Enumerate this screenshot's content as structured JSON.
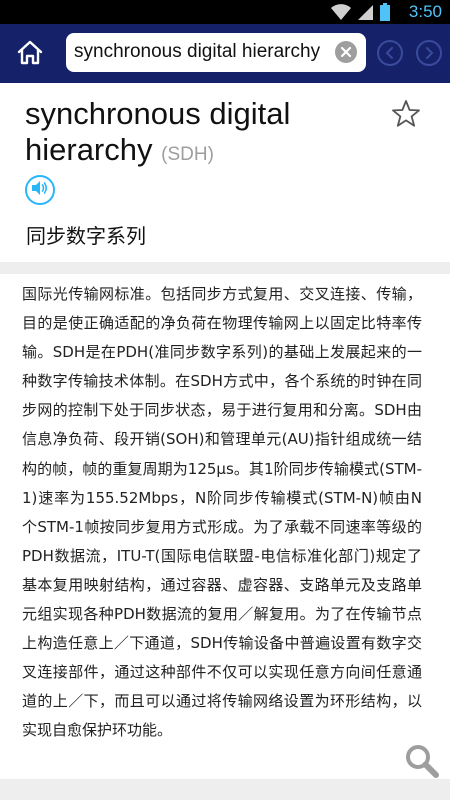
{
  "status_bar": {
    "time": "3:50",
    "icons": [
      "wifi-icon",
      "cell-signal-icon",
      "battery-icon"
    ]
  },
  "app_bar": {
    "search_value": "synchronous digital hierarchy",
    "icons": [
      "home-icon",
      "clear-icon",
      "back-arrow-icon",
      "forward-arrow-icon"
    ],
    "background_color": "#15226a"
  },
  "entry": {
    "term": "synchronous digital hierarchy",
    "abbreviation": "(SDH)",
    "translation": "同步数字系列",
    "definition": "国际光传输网标准。包括同步方式复用、交叉连接、传输，目的是使正确适配的净负荷在物理传输网上以固定比特率传输。SDH是在PDH(准同步数字系列)的基础上发展起来的一种数字传输技术体制。在SDH方式中，各个系统的时钟在同步网的控制下处于同步状态，易于进行复用和分离。SDH由信息净负荷、段开销(SOH)和管理单元(AU)指针组成统一结构的帧，帧的重复周期为125μs。其1阶同步传输模式(STM-1)速率为155.52Mbps，N阶同步传输模式(STM-N)帧由N个STM-1帧按同步复用方式形成。为了承载不同速率等级的PDH数据流，ITU-T(国际电信联盟-电信标准化部门)规定了基本复用映射结构，通过容器、虚容器、支路单元及支路单元组实现各种PDH数据流的复用／解复用。为了在传输节点上构造任意上／下通道，SDH传输设备中普遍设置有数字交叉连接部件，通过这种部件不仅可以实现任意方向间任意通道的上／下，而且可以通过将传输网络设置为环形结构，以实现自愈保护环功能。",
    "icons": [
      "star-icon",
      "speaker-icon",
      "search-icon"
    ],
    "accent_color": "#29b6f6"
  }
}
